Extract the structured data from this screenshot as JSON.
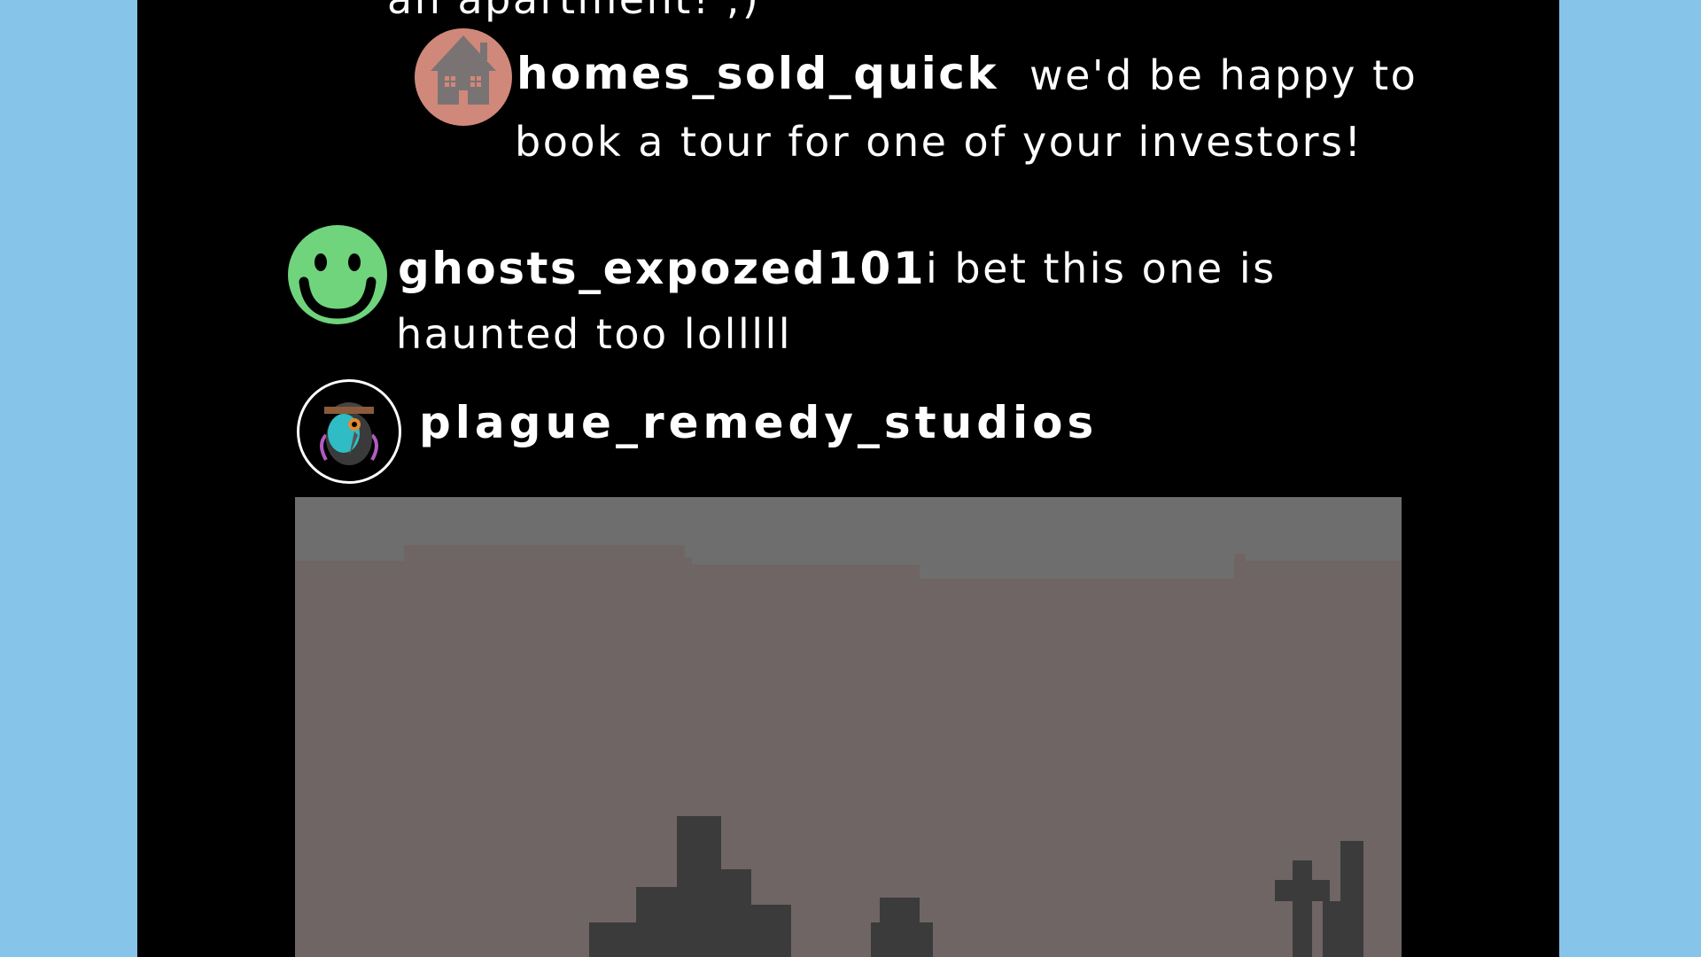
{
  "colors": {
    "page_background": "#87c4e9",
    "feed_background": "#000000",
    "text": "#ffffff",
    "homes_avatar": "#d0887a",
    "ghosts_avatar": "#6fd47c",
    "post_sky": "#6e6e6e",
    "post_wall": "#6f6565",
    "post_silhouette": "#3b3b3b"
  },
  "comments": [
    {
      "text_partial": "an apartment! ;)"
    },
    {
      "username": "homes_sold_quick",
      "avatar_icon": "house-icon",
      "text_line1": "we'd be happy to",
      "text_line2": "book a tour for one of your investors!"
    },
    {
      "username": "ghosts_expozed101",
      "avatar_icon": "smiley-face-icon",
      "text_line1": "i bet this one is",
      "text_line2": "haunted too lolllll"
    }
  ],
  "post": {
    "username": "plague_remedy_studios",
    "avatar_icon": "plague-doctor-icon",
    "image_description_icon": "graveyard-crosses-icon"
  }
}
